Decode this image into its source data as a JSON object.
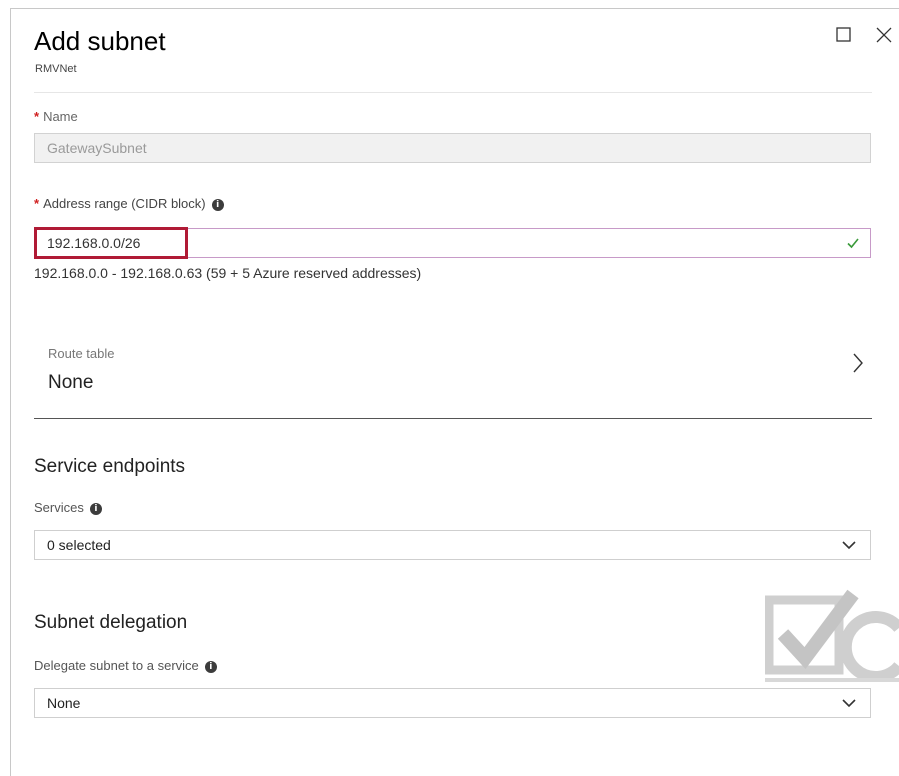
{
  "header": {
    "title": "Add subnet",
    "subtitle": "RMVNet"
  },
  "name_field": {
    "label": "Name",
    "value": "GatewaySubnet"
  },
  "address_field": {
    "label": "Address range (CIDR block)",
    "value": "192.168.0.0/26",
    "hint": "192.168.0.0 - 192.168.0.63 (59 + 5 Azure reserved addresses)"
  },
  "route_table": {
    "label": "Route table",
    "value": "None"
  },
  "service_endpoints": {
    "title": "Service endpoints",
    "services_label": "Services",
    "services_value": "0 selected"
  },
  "subnet_delegation": {
    "title": "Subnet delegation",
    "delegate_label": "Delegate subnet to a service",
    "delegate_value": "None"
  },
  "colors": {
    "required": "#d01f1f",
    "highlight": "#b01a35",
    "valid_check": "#3a9a3a"
  },
  "icons": [
    "maximize-icon",
    "close-icon",
    "info-icon",
    "check-icon",
    "chevron-right-icon",
    "chevron-down-icon"
  ]
}
